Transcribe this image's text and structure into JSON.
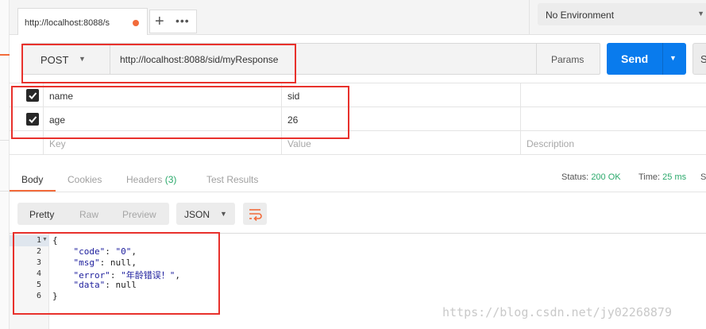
{
  "tab": {
    "title": "http://localhost:8088/s"
  },
  "tab_actions": {
    "new": "+",
    "more": "•••"
  },
  "environment": {
    "selected": "No Environment"
  },
  "request": {
    "method": "POST",
    "url": "http://localhost:8088/sid/myResponse",
    "params_label": "Params",
    "send_label": "Send",
    "save_label": "S"
  },
  "params": {
    "rows": [
      {
        "key": "name",
        "value": "sid",
        "checked": true
      },
      {
        "key": "age",
        "value": "26",
        "checked": true
      }
    ],
    "placeholders": {
      "key": "Key",
      "value": "Value",
      "description": "Description"
    }
  },
  "response": {
    "tabs": {
      "body": "Body",
      "cookies": "Cookies",
      "headers": "Headers",
      "headers_count": "(3)",
      "tests": "Test Results"
    },
    "status_label": "Status:",
    "status_value": "200 OK",
    "time_label": "Time:",
    "time_value": "25 ms",
    "size_label": "S",
    "format": {
      "pretty": "Pretty",
      "raw": "Raw",
      "preview": "Preview"
    },
    "language": "JSON",
    "line_numbers": [
      "1",
      "2",
      "3",
      "4",
      "5",
      "6"
    ],
    "code": {
      "open": "{",
      "code_key": "\"code\"",
      "code_val": "\"0\"",
      "msg_key": "\"msg\"",
      "msg_val": "null",
      "error_key": "\"error\"",
      "error_val": "\"年龄错误！\"",
      "data_key": "\"data\"",
      "data_val": "null",
      "close": "}"
    }
  },
  "watermark": "https://blog.csdn.net/jy02268879",
  "colors": {
    "accent": "#f26b3a",
    "send": "#097bed",
    "success": "#2aa96b",
    "annotation": "#e8312c"
  }
}
